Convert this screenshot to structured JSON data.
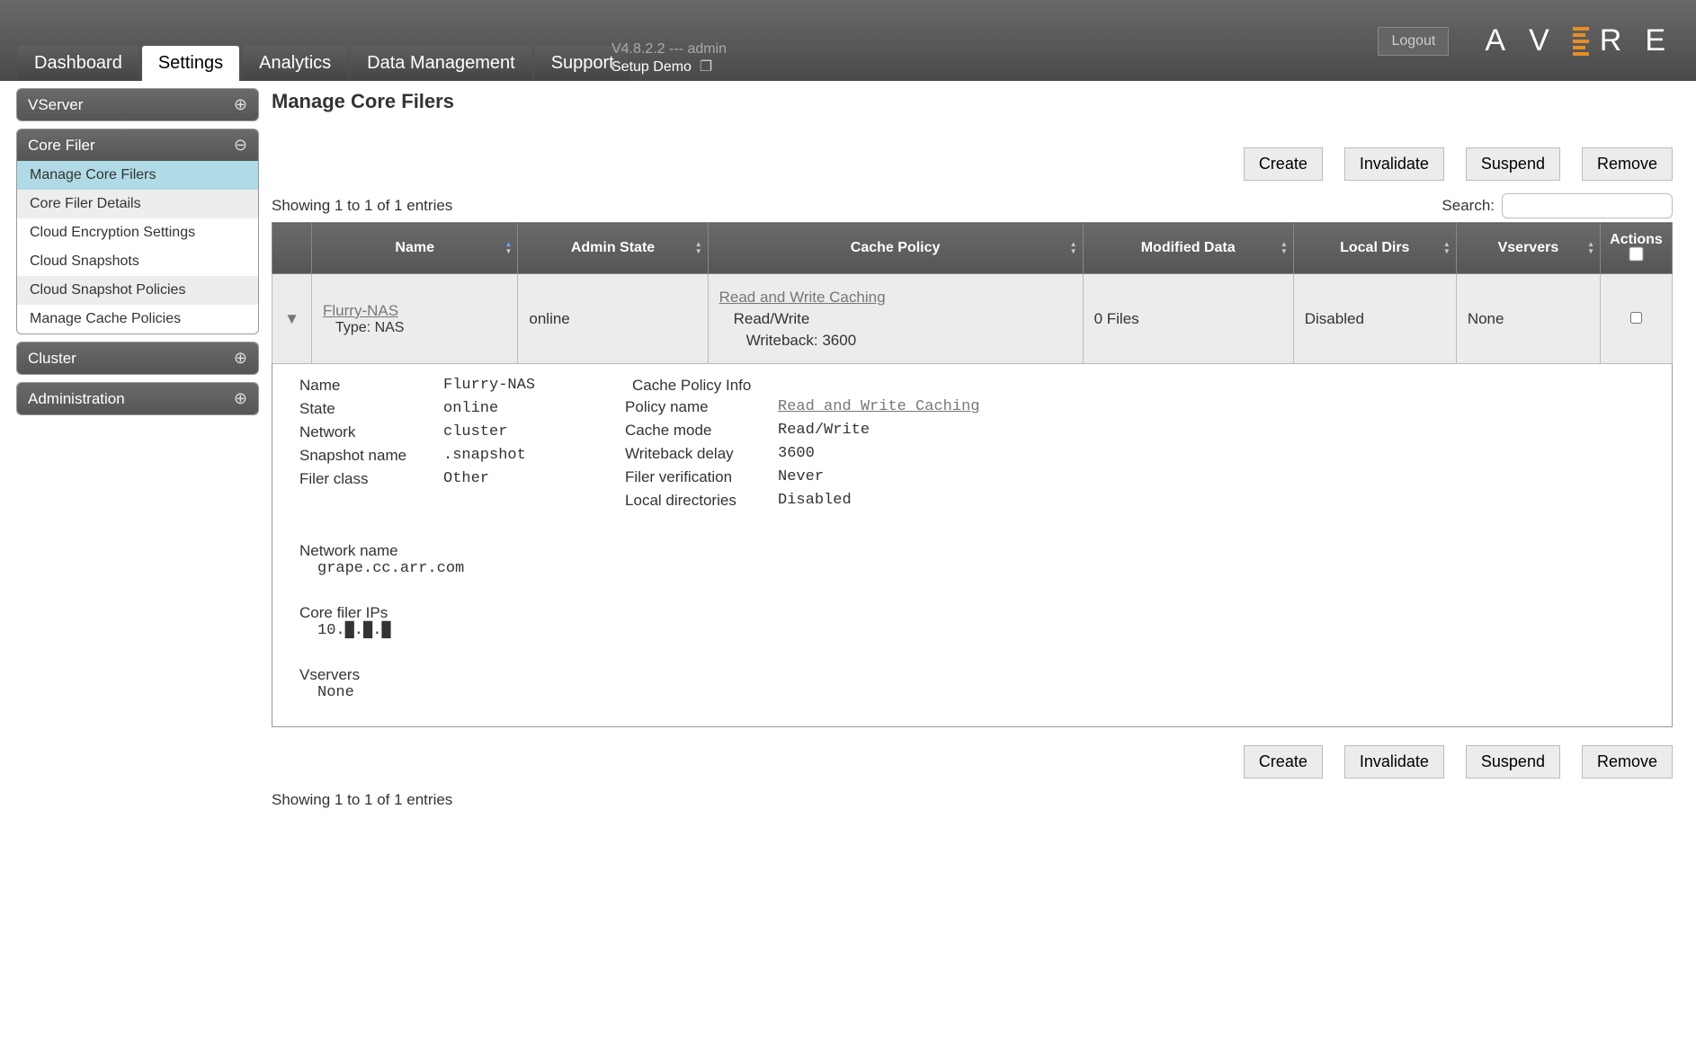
{
  "header": {
    "logout": "Logout",
    "version": "V4.8.2.2 --- admin",
    "setup_demo": "Setup Demo",
    "tabs": [
      "Dashboard",
      "Settings",
      "Analytics",
      "Data Management",
      "Support"
    ],
    "active_tab": 1
  },
  "sidebar": {
    "groups": [
      {
        "title": "VServer",
        "expanded": false,
        "items": []
      },
      {
        "title": "Core Filer",
        "expanded": true,
        "items": [
          "Manage Core Filers",
          "Core Filer Details",
          "Cloud Encryption Settings",
          "Cloud Snapshots",
          "Cloud Snapshot Policies",
          "Manage Cache Policies"
        ],
        "active_index": 0,
        "alt_indices": [
          1,
          4
        ]
      },
      {
        "title": "Cluster",
        "expanded": false,
        "items": []
      },
      {
        "title": "Administration",
        "expanded": false,
        "items": []
      }
    ]
  },
  "page": {
    "title": "Manage Core Filers",
    "actions": [
      "Create",
      "Invalidate",
      "Suspend",
      "Remove"
    ],
    "showing": "Showing 1 to 1 of 1 entries",
    "search_label": "Search:"
  },
  "table": {
    "columns": [
      "",
      "Name",
      "Admin State",
      "Cache Policy",
      "Modified Data",
      "Local Dirs",
      "Vservers",
      "Actions"
    ],
    "row": {
      "name_link": "Flurry-NAS",
      "type_line": "Type: NAS",
      "admin_state": "online",
      "cache_link": "Read and Write Caching",
      "cache_mode": "Read/Write",
      "cache_wb": "Writeback: 3600",
      "modified": "0 Files",
      "local_dirs": "Disabled",
      "vservers": "None"
    }
  },
  "details": {
    "left": {
      "Name": "Flurry-NAS",
      "State": "online",
      "Network": "cluster",
      "Snapshot name": ".snapshot",
      "Filer class": "Other"
    },
    "policy_title": "Cache Policy Info",
    "right": {
      "Policy name": {
        "link": "Read and Write Caching"
      },
      "Cache mode": "Read/Write",
      "Writeback delay": "3600",
      "Filer verification": "Never",
      "Local directories": "Disabled"
    },
    "network_name_label": "Network name",
    "network_name": "grape.cc.arr.com",
    "core_ips_label": "Core filer IPs",
    "core_ips": "10.█.█.█",
    "vservers_label": "Vservers",
    "vservers": "None"
  }
}
